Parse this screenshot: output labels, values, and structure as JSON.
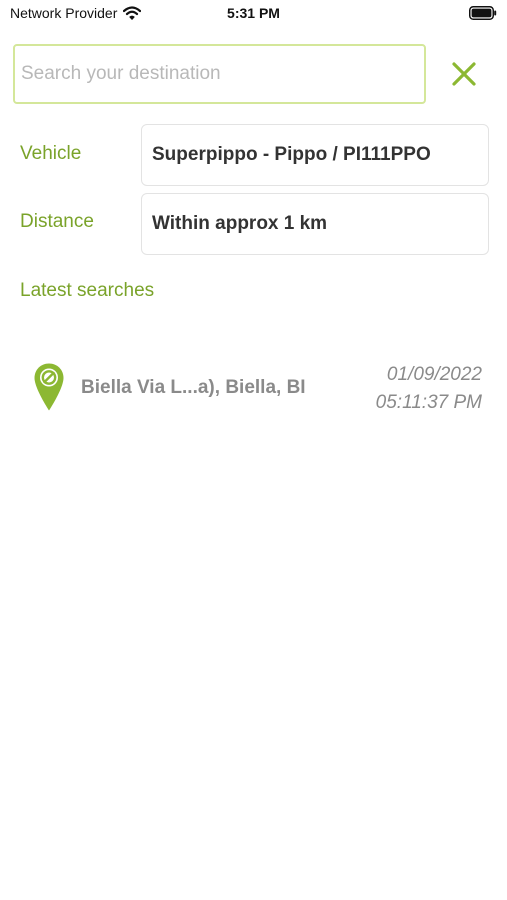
{
  "status_bar": {
    "carrier": "Network Provider",
    "time": "5:31 PM",
    "icons": [
      "wifi-icon",
      "battery-icon"
    ]
  },
  "search": {
    "value": "",
    "placeholder": "Search your destination",
    "close_icon": "close-icon"
  },
  "filters": {
    "vehicle": {
      "label": "Vehicle",
      "value": "Superpippo - Pippo / PI111PPO"
    },
    "distance": {
      "label": "Distance",
      "value": "Within approx 1 km"
    }
  },
  "latest_searches": {
    "title": "Latest searches",
    "items": [
      {
        "icon": "map-pin-icon",
        "address": "Biella Via L...a), Biella, BI",
        "date": "01/09/2022",
        "time": "05:11:37 PM"
      }
    ]
  },
  "colors": {
    "accent": "#7aa32a",
    "search_border": "#d4e79a",
    "close_icon": "#8cb832",
    "pin": "#8cb832",
    "muted_text": "#8a8a8a",
    "field_border": "#e3e3e3"
  }
}
